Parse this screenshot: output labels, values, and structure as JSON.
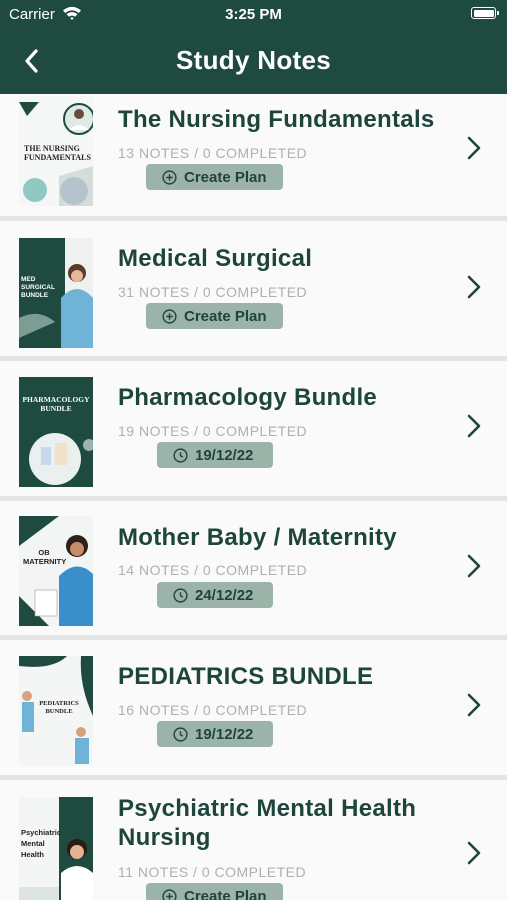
{
  "status_bar": {
    "carrier": "Carrier",
    "time": "3:25 PM"
  },
  "header": {
    "title": "Study Notes",
    "back_icon": "chevron-left-icon"
  },
  "cards": [
    {
      "title": "The Nursing Fundamentals",
      "meta": "13  NOTES / 0 COMPLETED",
      "action": "Create Plan",
      "action_icon": "plus-circle-icon",
      "cover_text": "THE NURSING FUNDAMENTALS"
    },
    {
      "title": "Medical Surgical",
      "meta": "31  NOTES / 0 COMPLETED",
      "action": "Create Plan",
      "action_icon": "plus-circle-icon",
      "cover_text": "MED SURGICAL BUNDLE"
    },
    {
      "title": "Pharmacology Bundle",
      "meta": "19  NOTES / 0 COMPLETED",
      "action": "19/12/22",
      "action_icon": "clock-icon",
      "cover_text": "PHARMACOLOGY BUNDLE"
    },
    {
      "title": "Mother Baby / Maternity",
      "meta": "14  NOTES / 0 COMPLETED",
      "action": "24/12/22",
      "action_icon": "clock-icon",
      "cover_text": "OB MATERNITY"
    },
    {
      "title": "PEDIATRICS BUNDLE",
      "meta": "16  NOTES / 0 COMPLETED",
      "action": "19/12/22",
      "action_icon": "clock-icon",
      "cover_text": "PEDIATRICS BUNDLE"
    },
    {
      "title": "Psychiatric Mental Health Nursing",
      "meta": "11  NOTES / 0 COMPLETED",
      "action": "Create Plan",
      "action_icon": "plus-circle-icon",
      "cover_text": "Psychiatric Mental Health"
    }
  ],
  "colors": {
    "primary": "#1f4a40",
    "pill": "#9cb3a9",
    "meta": "#b0b0b0",
    "divider": "#e4e4e4"
  }
}
